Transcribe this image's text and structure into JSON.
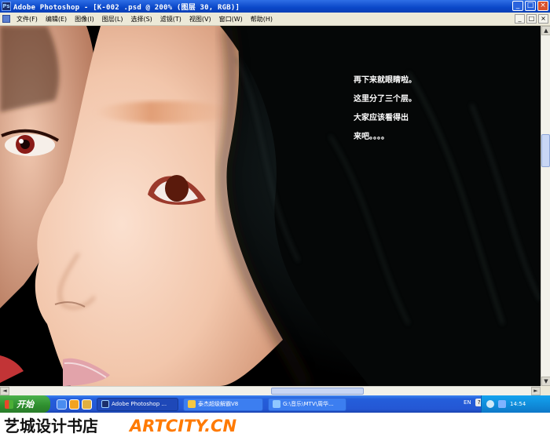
{
  "window": {
    "title": "Adobe Photoshop - [K-002 .psd @ 200% (图层 30, RGB)]",
    "app_icon": "Ps",
    "controls": [
      "_",
      "□",
      "×"
    ]
  },
  "menubar": {
    "items": [
      "文件(F)",
      "编辑(E)",
      "图像(I)",
      "图层(L)",
      "选择(S)",
      "滤镜(T)",
      "视图(V)",
      "窗口(W)",
      "帮助(H)"
    ]
  },
  "canvas": {
    "annotation_lines": [
      "再下来就眼睛啦。",
      "这里分了三个层。",
      "大家应该看得出",
      "来吧。。。。"
    ]
  },
  "scrollbars": {
    "vertical_up": "▲",
    "vertical_down": "▼",
    "horizontal_left": "◄",
    "horizontal_right": "►"
  },
  "taskbar": {
    "start_label": "开始",
    "tasks": [
      {
        "label": "Adobe Photoshop ...",
        "active": true
      },
      {
        "label": "泰杰超级解霸V8",
        "active": false
      },
      {
        "label": "G:\\音乐\\MTV\\周华...",
        "active": false
      }
    ],
    "lang": "EN",
    "clock": "14:54"
  },
  "watermark": {
    "brand_cn": "艺城设计书店",
    "brand_en": "ARTCITY.CN"
  },
  "colors": {
    "title_bar": "#0a47c8",
    "taskbar": "#245edb",
    "start": "#2e8e2e",
    "watermark_orange": "#ff7a00"
  }
}
